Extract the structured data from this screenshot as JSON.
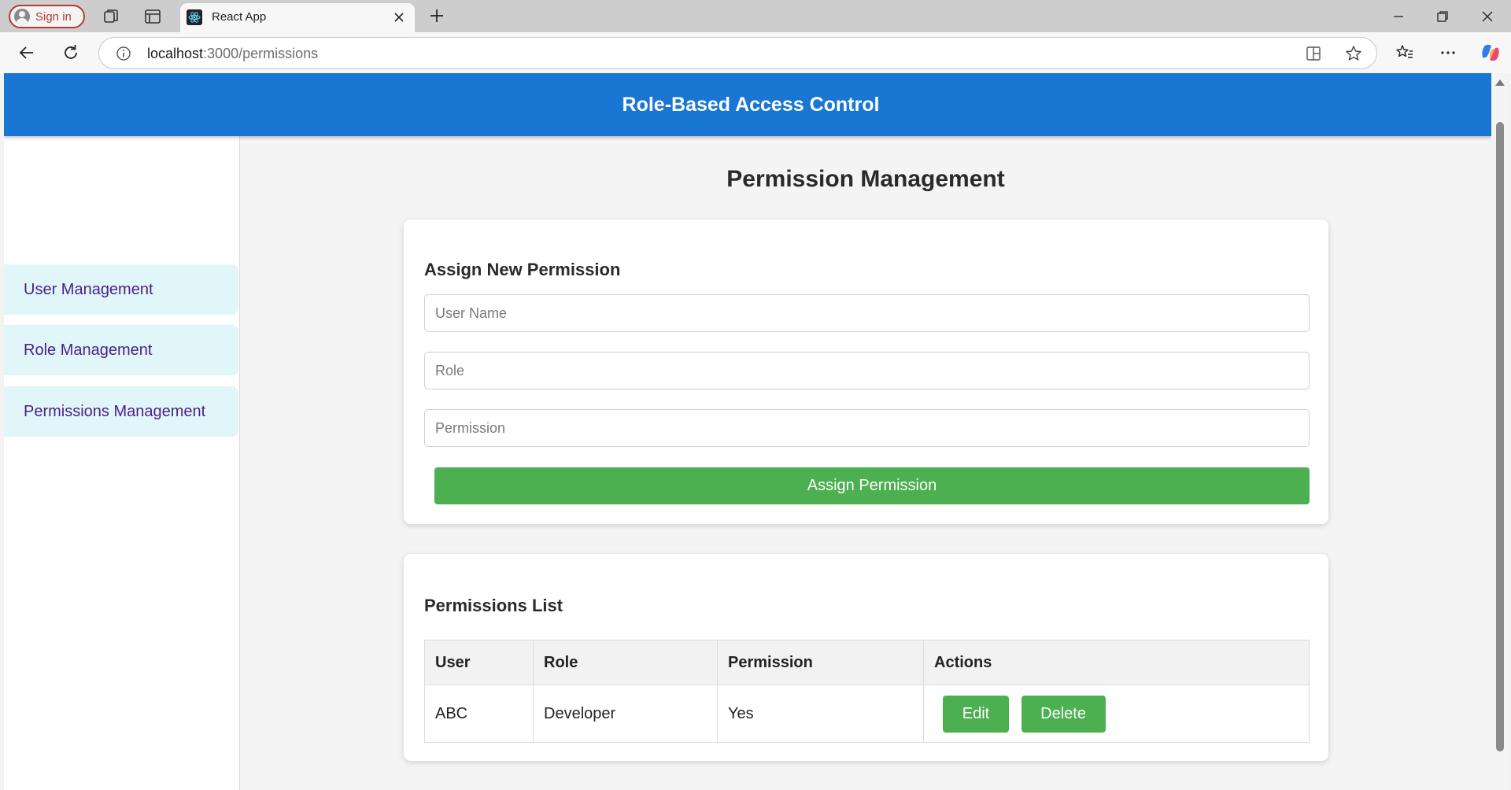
{
  "browser": {
    "signin_label": "Sign in",
    "tab_title": "React App",
    "url_host": "localhost",
    "url_path": ":3000/permissions"
  },
  "header": {
    "title": "Role-Based Access Control"
  },
  "sidebar": {
    "items": [
      {
        "label": "User Management"
      },
      {
        "label": "Role Management"
      },
      {
        "label": "Permissions Management"
      }
    ]
  },
  "main": {
    "title": "Permission Management",
    "assign_form": {
      "heading": "Assign New Permission",
      "user_placeholder": "User Name",
      "role_placeholder": "Role",
      "permission_placeholder": "Permission",
      "submit_label": "Assign Permission"
    },
    "list": {
      "heading": "Permissions List",
      "columns": [
        "User",
        "Role",
        "Permission",
        "Actions"
      ],
      "rows": [
        {
          "user": "ABC",
          "role": "Developer",
          "permission": "Yes",
          "edit_label": "Edit",
          "delete_label": "Delete"
        }
      ]
    }
  },
  "colors": {
    "header_bg": "#1976d2",
    "button_green": "#4caf50",
    "sidebar_item_bg": "#e0f6f8",
    "sidebar_text": "#4a1f86"
  }
}
